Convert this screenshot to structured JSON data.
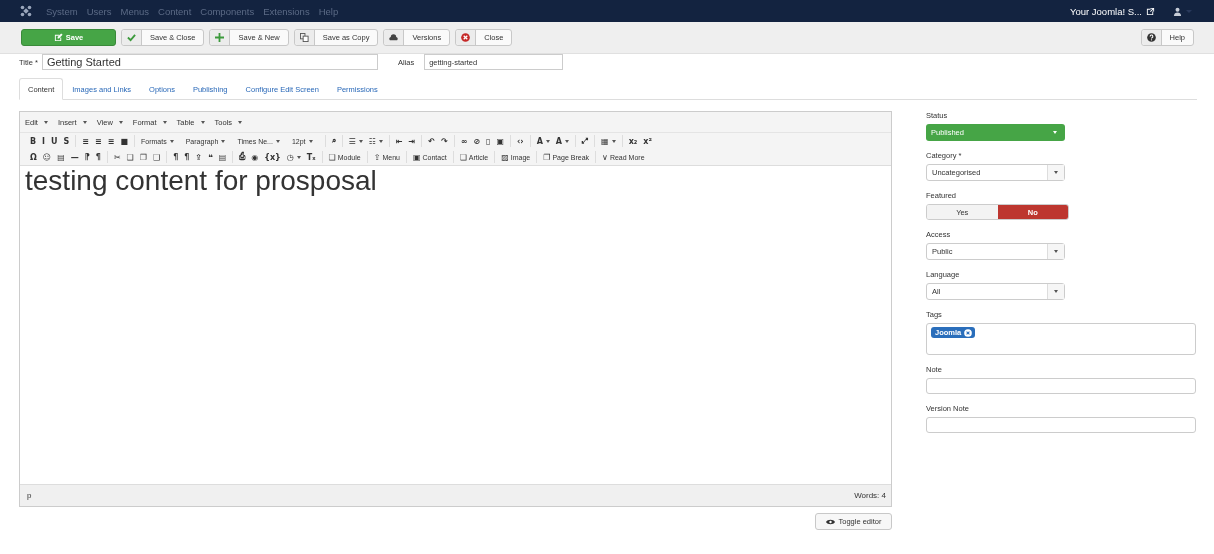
{
  "nav": {
    "menu": [
      {
        "label": "System",
        "disabled": true
      },
      {
        "label": "Users",
        "disabled": true
      },
      {
        "label": "Menus",
        "disabled": true
      },
      {
        "label": "Content",
        "disabled": true
      },
      {
        "label": "Components",
        "disabled": true
      },
      {
        "label": "Extensions",
        "disabled": true
      },
      {
        "label": "Help",
        "disabled": true
      }
    ],
    "site_link": "Your Joomla! S..."
  },
  "toolbar": {
    "buttons": [
      {
        "label": "Save",
        "kind": "primary"
      },
      {
        "label": "Save & Close",
        "kind": "default"
      },
      {
        "label": "Save & New",
        "kind": "default"
      },
      {
        "label": "Save as Copy",
        "kind": "default"
      },
      {
        "label": "Versions",
        "kind": "default"
      },
      {
        "label": "Close",
        "kind": "default"
      }
    ],
    "help": "Help"
  },
  "title": {
    "label": "Title *",
    "value": "Getting Started"
  },
  "alias": {
    "label": "Alias",
    "value": "getting-started"
  },
  "tabs": [
    {
      "label": "Content",
      "selected": true
    },
    {
      "label": "Images and Links",
      "selected": false
    },
    {
      "label": "Options",
      "selected": false
    },
    {
      "label": "Publishing",
      "selected": false
    },
    {
      "label": "Configure Edit Screen",
      "selected": false
    },
    {
      "label": "Permissions",
      "selected": false
    }
  ],
  "editor": {
    "menus": [
      "Edit",
      "Insert",
      "View",
      "Format",
      "Table",
      "Tools"
    ],
    "toolbar_rows": [
      [
        [
          {
            "kind": "glyph",
            "text": "B"
          },
          {
            "kind": "glyph",
            "text": "I"
          },
          {
            "kind": "glyph",
            "text": "U"
          },
          {
            "kind": "glyph",
            "text": "S"
          }
        ],
        [
          {
            "kind": "glyph",
            "text": "≡"
          },
          {
            "kind": "glyph",
            "text": "≡"
          },
          {
            "kind": "glyph",
            "text": "≡"
          },
          {
            "kind": "glyph",
            "text": "■"
          }
        ],
        [
          {
            "kind": "menu",
            "text": "Formats"
          },
          {
            "kind": "menu",
            "text": "Paragraph"
          },
          {
            "kind": "menu",
            "text": "Times Ne..."
          },
          {
            "kind": "menu",
            "text": "12pt"
          }
        ],
        [
          {
            "kind": "glyph",
            "text": "⌕"
          }
        ],
        [
          {
            "kind": "split",
            "text": "☰"
          },
          {
            "kind": "split",
            "text": "☷"
          }
        ],
        [
          {
            "kind": "glyph",
            "text": "⇤"
          },
          {
            "kind": "glyph",
            "text": "⇥"
          }
        ],
        [
          {
            "kind": "glyph",
            "text": "↶"
          },
          {
            "kind": "glyph",
            "text": "↷"
          }
        ],
        [
          {
            "kind": "glyph",
            "text": "∞"
          },
          {
            "kind": "glyph",
            "text": "⊘"
          },
          {
            "kind": "glyph",
            "text": "▯"
          },
          {
            "kind": "glyph",
            "text": "▣"
          }
        ],
        [
          {
            "kind": "glyph",
            "text": "‹›"
          }
        ],
        [
          {
            "kind": "split",
            "text": "A"
          },
          {
            "kind": "split",
            "text": "A"
          }
        ],
        [
          {
            "kind": "glyph",
            "text": "⤢"
          }
        ],
        [
          {
            "kind": "split",
            "text": "▦"
          }
        ],
        [
          {
            "kind": "glyph",
            "text": "x₂"
          },
          {
            "kind": "glyph",
            "text": "x²"
          }
        ]
      ],
      [
        [
          {
            "kind": "glyph",
            "text": "Ω"
          },
          {
            "kind": "glyph",
            "text": "☺"
          },
          {
            "kind": "glyph",
            "text": "▤"
          },
          {
            "kind": "glyph",
            "text": "—"
          },
          {
            "kind": "glyph",
            "text": "⁋"
          },
          {
            "kind": "glyph",
            "text": "¶"
          }
        ],
        [
          {
            "kind": "glyph",
            "text": "✂"
          },
          {
            "kind": "glyph",
            "text": "❏"
          },
          {
            "kind": "glyph",
            "text": "❐"
          },
          {
            "kind": "glyph",
            "text": "❑"
          }
        ],
        [
          {
            "kind": "glyph",
            "text": "¶"
          },
          {
            "kind": "glyph",
            "text": "¶"
          },
          {
            "kind": "glyph",
            "text": "⇪"
          },
          {
            "kind": "glyph",
            "text": "❝"
          },
          {
            "kind": "glyph",
            "text": "▤"
          }
        ],
        [
          {
            "kind": "glyph",
            "text": "⎙"
          },
          {
            "kind": "glyph",
            "text": "◉"
          },
          {
            "kind": "glyph",
            "text": "{x}"
          },
          {
            "kind": "split",
            "text": "◷"
          },
          {
            "kind": "glyph",
            "text": "Tₓ"
          }
        ],
        [
          {
            "kind": "labeled",
            "icon": "❏",
            "text": "Module"
          }
        ],
        [
          {
            "kind": "labeled",
            "icon": "⇪",
            "text": "Menu"
          }
        ],
        [
          {
            "kind": "labeled",
            "icon": "▣",
            "text": "Contact"
          }
        ],
        [
          {
            "kind": "labeled",
            "icon": "❏",
            "text": "Article"
          }
        ],
        [
          {
            "kind": "labeled",
            "icon": "▨",
            "text": "Image"
          }
        ],
        [
          {
            "kind": "labeled",
            "icon": "❐",
            "text": "Page Break"
          }
        ],
        [
          {
            "kind": "labeled",
            "icon": "∨",
            "text": "Read More"
          }
        ]
      ]
    ],
    "content": "testing content for prosposal",
    "path": "p",
    "word_count": "Words: 4"
  },
  "toggle_button": "Toggle editor",
  "fields": [
    {
      "kind": "status",
      "label": "Status",
      "value": "Published"
    },
    {
      "kind": "select",
      "label": "Category *",
      "value": "Uncategorised"
    },
    {
      "kind": "toggle",
      "label": "Featured",
      "options": [
        {
          "label": "Yes",
          "selected": false
        },
        {
          "label": "No",
          "selected": true
        }
      ]
    },
    {
      "kind": "select",
      "label": "Access",
      "value": "Public"
    },
    {
      "kind": "select",
      "label": "Language",
      "value": "All"
    },
    {
      "kind": "tags",
      "label": "Tags",
      "tags": [
        "Joomla"
      ]
    },
    {
      "kind": "text",
      "label": "Note"
    },
    {
      "kind": "text",
      "label": "Version Note"
    }
  ]
}
